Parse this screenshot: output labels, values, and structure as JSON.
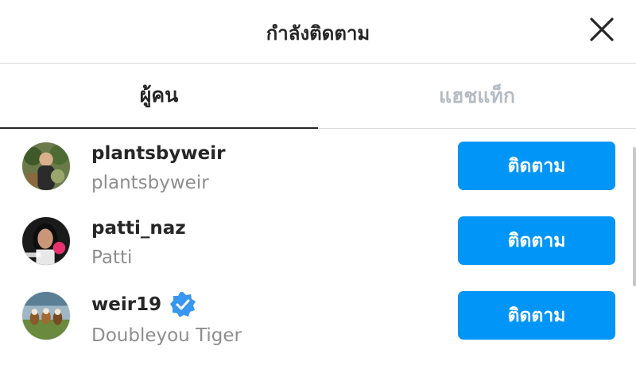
{
  "header": {
    "title": "กำลังติดตาม"
  },
  "tabs": [
    {
      "label": "ผู้คน"
    },
    {
      "label": "แฮชแท็ก"
    }
  ],
  "accounts": [
    {
      "username": "plantsbyweir",
      "full_name": "plantsbyweir",
      "verified": false,
      "button": "ติดตาม"
    },
    {
      "username": "patti_naz",
      "full_name": "Patti",
      "verified": false,
      "button": "ติดตาม"
    },
    {
      "username": "weir19",
      "full_name": "Doubleyou Tiger",
      "verified": true,
      "button": "ติดตาม"
    }
  ],
  "colors": {
    "accent": "#0095f6",
    "text": "#262626",
    "muted": "#8e8e8e",
    "inactive_tab": "#b6bcc4"
  },
  "icons": {
    "close": "close-icon",
    "verified": "verified-badge-icon"
  }
}
